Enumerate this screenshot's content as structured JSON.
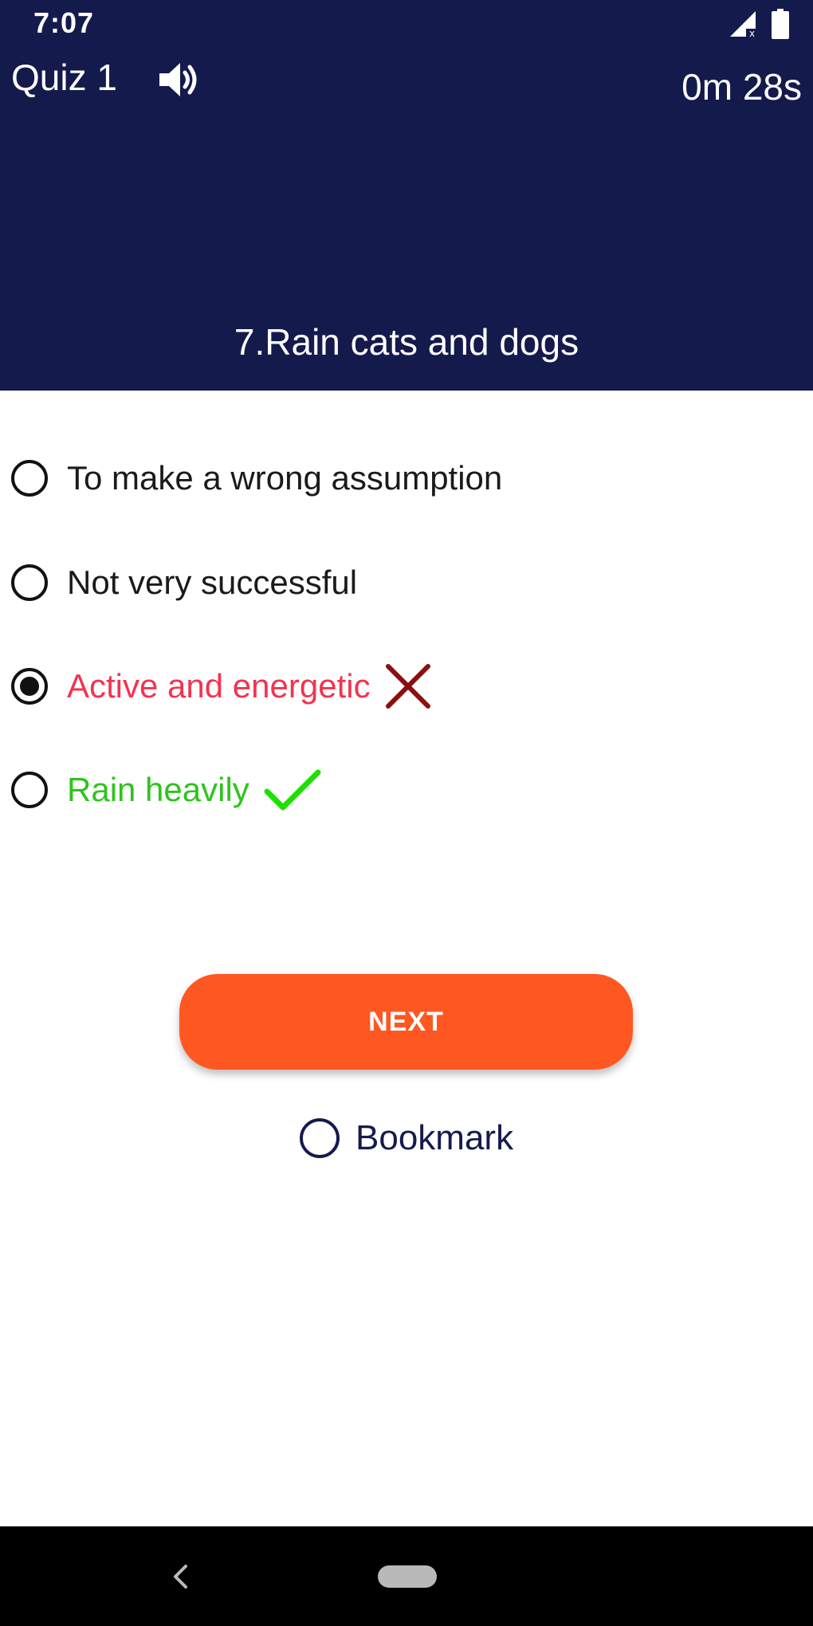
{
  "status_bar": {
    "time": "7:07",
    "icons": [
      "signal-icon",
      "battery-icon"
    ]
  },
  "header": {
    "quiz_title": "Quiz 1",
    "sound_icon": "speaker-icon",
    "timer": "0m 28s",
    "question": "7.Rain cats and dogs",
    "background_color": "#151a4d"
  },
  "options": [
    {
      "label": "To make a wrong assumption",
      "selected": false,
      "state": "neutral"
    },
    {
      "label": "Not very successful",
      "selected": false,
      "state": "neutral"
    },
    {
      "label": "Active and energetic",
      "selected": true,
      "state": "wrong",
      "mark_icon": "cross-icon"
    },
    {
      "label": "Rain heavily",
      "selected": false,
      "state": "correct",
      "mark_icon": "check-icon"
    }
  ],
  "colors": {
    "wrong_text": "#f2344f",
    "wrong_mark": "#8b0f0f",
    "correct_text": "#2ec41c",
    "correct_mark": "#1ee000",
    "next_button": "#ff5722"
  },
  "next_button": {
    "label": "NEXT"
  },
  "bookmark": {
    "label": "Bookmark",
    "checked": false
  },
  "nav_bar": {
    "icons": [
      "back-icon",
      "home-pill-icon"
    ]
  }
}
